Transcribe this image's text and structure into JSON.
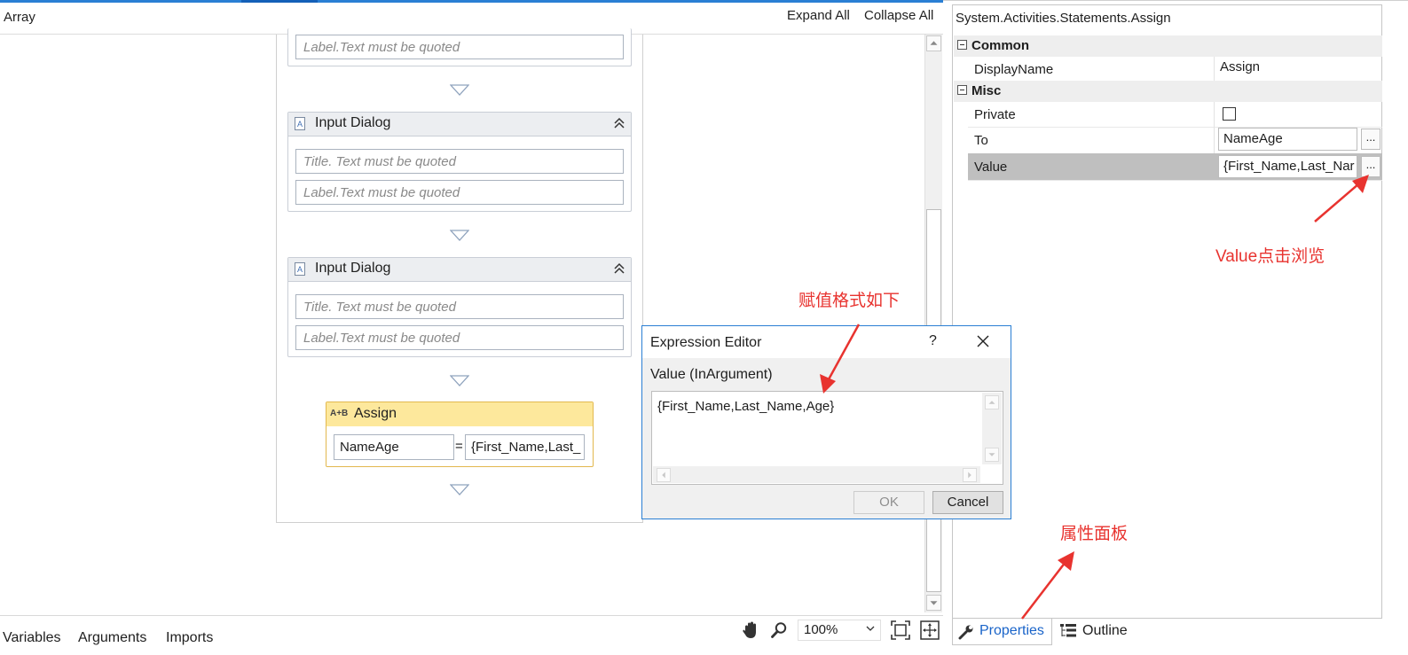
{
  "designer": {
    "breadcrumb": "Array",
    "expand_all": "Expand All",
    "collapse_all": "Collapse All"
  },
  "canvas": {
    "top_field_placeholder": "Label.Text must be quoted",
    "activities": [
      {
        "title": "Input Dialog",
        "title_placeholder": "Title. Text must be quoted",
        "label_placeholder": "Label.Text must be quoted"
      },
      {
        "title": "Input Dialog",
        "title_placeholder": "Title. Text must be quoted",
        "label_placeholder": "Label.Text must be quoted"
      }
    ],
    "assign": {
      "icon_text": "A+B",
      "title": "Assign",
      "to": "NameAge",
      "equals": "=",
      "value": "{First_Name,Last_"
    }
  },
  "bottom_bar": {
    "tabs": [
      "Variables",
      "Arguments",
      "Imports"
    ],
    "zoom": "100%"
  },
  "properties": {
    "type_title": "System.Activities.Statements.Assign",
    "categories": {
      "common": "Common",
      "misc": "Misc"
    },
    "rows": {
      "display_name": {
        "name": "DisplayName",
        "value": "Assign"
      },
      "private": {
        "name": "Private",
        "checked": false
      },
      "to": {
        "name": "To",
        "value": "NameAge"
      },
      "value": {
        "name": "Value",
        "value": "{First_Name,Last_Nar"
      }
    },
    "ellipsis": "...",
    "tabs": {
      "properties": "Properties",
      "outline": "Outline"
    }
  },
  "expression_editor": {
    "title": "Expression Editor",
    "help": "?",
    "label": "Value (InArgument)",
    "text": "{First_Name,Last_Name,Age}",
    "ok": "OK",
    "cancel": "Cancel"
  },
  "annotations": {
    "format_note": "赋值格式如下",
    "value_note": "Value点击浏览",
    "panel_note": "属性面板"
  },
  "colors": {
    "accent": "#2a7fd4",
    "annotation": "#e8332f",
    "assign_header": "#fde89c",
    "selected_row": "#bfbfbf"
  }
}
